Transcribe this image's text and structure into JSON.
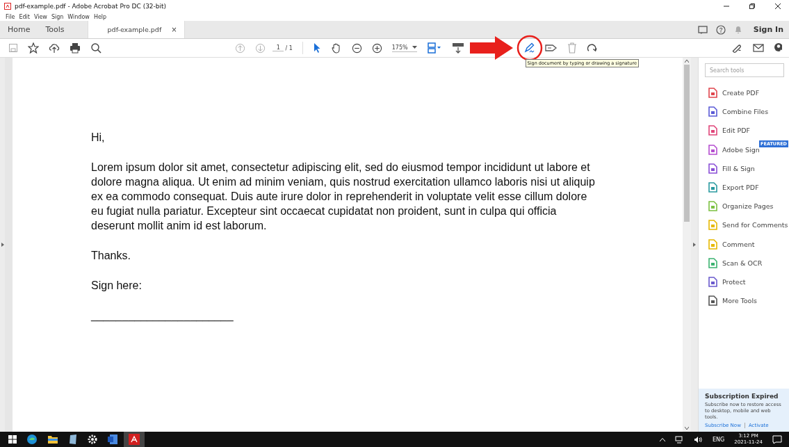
{
  "window": {
    "title": "pdf-example.pdf - Adobe Acrobat Pro DC (32-bit)"
  },
  "menu": [
    "File",
    "Edit",
    "View",
    "Sign",
    "Window",
    "Help"
  ],
  "tabs": [
    {
      "label": "Home",
      "selected": false
    },
    {
      "label": "Tools",
      "selected": false
    },
    {
      "label": "pdf-example.pdf",
      "selected": true,
      "close": "×"
    }
  ],
  "header_right": {
    "sign_in": "Sign In"
  },
  "toolbar": {
    "page": "1",
    "page_total": "/ 1",
    "zoom": "175%",
    "tooltip": "Sign document by typing or drawing a signature"
  },
  "document": {
    "paragraphs": [
      "Hi,",
      "Lorem ipsum dolor sit amet, consectetur adipiscing elit, sed do eiusmod tempor incididunt ut labore et dolore magna aliqua. Ut enim ad minim veniam, quis nostrud exercitation ullamco laboris nisi ut aliquip ex ea commodo consequat. Duis aute irure dolor in reprehenderit in voluptate velit esse cillum dolore eu fugiat nulla pariatur. Excepteur sint occaecat cupidatat non proident, sunt in culpa qui officia deserunt mollit anim id est laborum.",
      "Thanks.",
      "Sign here:",
      "_______________________"
    ]
  },
  "tools_panel": {
    "search": {
      "placeholder": "Search tools"
    },
    "tools": [
      {
        "label": "Create PDF",
        "color": "#e0464e"
      },
      {
        "label": "Combine Files",
        "color": "#5b5bd6"
      },
      {
        "label": "Edit PDF",
        "color": "#e0467a"
      },
      {
        "label": "Adobe Sign",
        "color": "#b54ed0",
        "badge": "FEATURED"
      },
      {
        "label": "Fill & Sign",
        "color": "#8a4fd6"
      },
      {
        "label": "Export PDF",
        "color": "#2a9aa0"
      },
      {
        "label": "Organize Pages",
        "color": "#7cc142"
      },
      {
        "label": "Send for Comments",
        "color": "#e6b800"
      },
      {
        "label": "Comment",
        "color": "#e6b800"
      },
      {
        "label": "Scan & OCR",
        "color": "#3cb371"
      },
      {
        "label": "Protect",
        "color": "#6a5acd"
      },
      {
        "label": "More Tools",
        "color": "#555555"
      }
    ],
    "subscription": {
      "title": "Subscription Expired",
      "text": "Subscribe now to restore access to desktop, mobile and web tools.",
      "links": [
        "Subscribe Now",
        "Activate"
      ]
    }
  },
  "taskbar": {
    "language": "ENG",
    "time": "3:12 PM",
    "date": "2021-11-24"
  }
}
